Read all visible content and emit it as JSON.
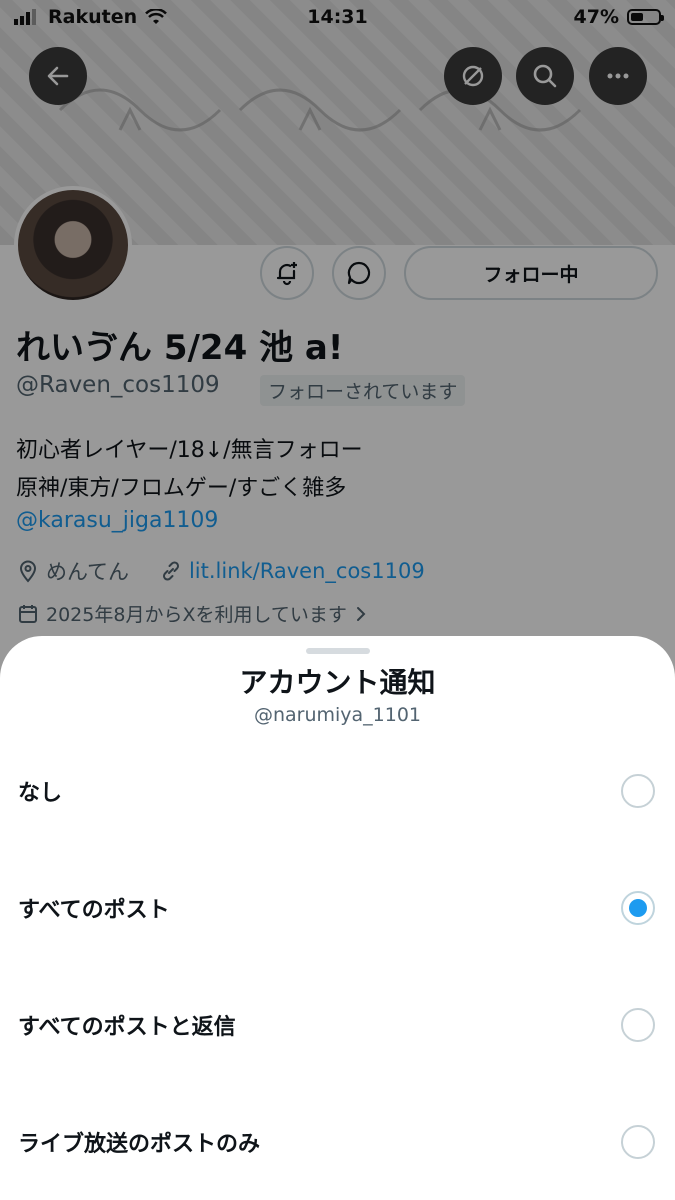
{
  "status_bar": {
    "carrier": "Rakuten",
    "time": "14:31",
    "battery": "47%",
    "battery_level": 0.47
  },
  "header": {
    "back_icon": "arrow-left-icon",
    "grok_icon": "slashed-circle-icon",
    "search_icon": "search-icon",
    "more_icon": "more-horizontal-icon"
  },
  "profile": {
    "display_name": "れいゔん 5/24 池 a!",
    "handle": "@Raven_cos1109",
    "follows_you": "フォローされています",
    "follow_button": "フォロー中",
    "bio_lines": [
      "初心者レイヤー/18↓/無言フォロー",
      "原神/東方/フロムゲー/すごく雑多"
    ],
    "bio_mention": "@karasu_jiga1109",
    "location": "めんてん",
    "website": "lit.link/Raven_cos1109",
    "joined": "2025年8月からXを利用しています"
  },
  "sheet": {
    "title": "アカウント通知",
    "subtitle": "@narumiya_1101",
    "options": [
      {
        "label": "なし",
        "selected": false
      },
      {
        "label": "すべてのポスト",
        "selected": true
      },
      {
        "label": "すべてのポストと返信",
        "selected": false
      },
      {
        "label": "ライブ放送のポストのみ",
        "selected": false
      }
    ]
  },
  "colors": {
    "accent": "#1d9bf0",
    "text": "#0f1419",
    "secondary": "#536471"
  }
}
